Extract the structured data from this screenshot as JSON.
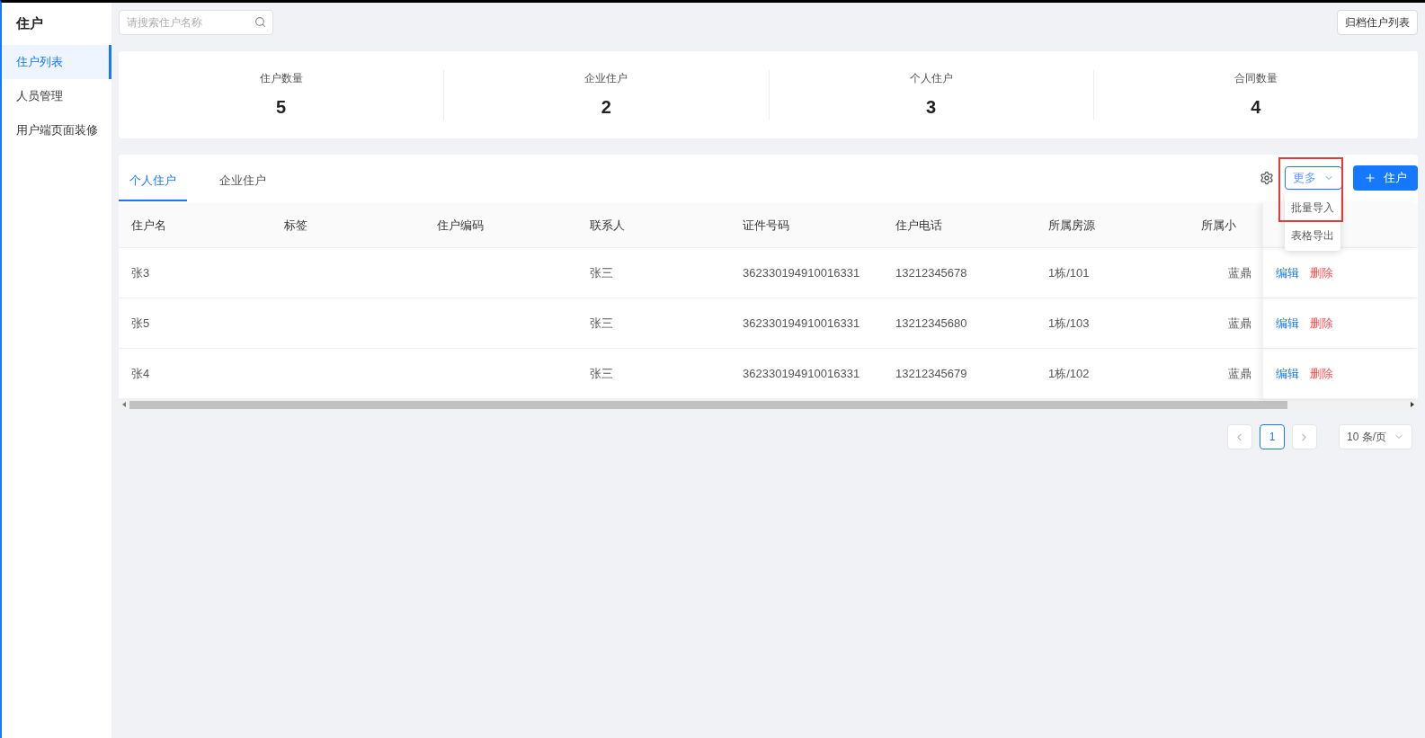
{
  "sidebar": {
    "title": "住户",
    "items": [
      {
        "label": "住户列表",
        "selected": true
      },
      {
        "label": "人员管理",
        "selected": false
      },
      {
        "label": "用户端页面装修",
        "selected": false
      }
    ]
  },
  "search": {
    "placeholder": "请搜索住户名称"
  },
  "archive_button": "归档住户列表",
  "stats": [
    {
      "label": "住户数量",
      "value": "5"
    },
    {
      "label": "企业住户",
      "value": "2"
    },
    {
      "label": "个人住户",
      "value": "3"
    },
    {
      "label": "合同数量",
      "value": "4"
    }
  ],
  "tabs": [
    {
      "label": "个人住户",
      "selected": true
    },
    {
      "label": "企业住户",
      "selected": false
    }
  ],
  "more_menu": {
    "label": "更多",
    "open": true,
    "highlighted": true,
    "items": [
      "批量导入",
      "表格导出"
    ]
  },
  "add_button": "住户",
  "table": {
    "columns": [
      "住户名",
      "标签",
      "住户编码",
      "联系人",
      "证件号码",
      "住户电话",
      "所属房源",
      "所属小"
    ],
    "rows": [
      {
        "name": "张3",
        "contact": "张三",
        "id_number": "362330194910016331",
        "phone": "13212345678",
        "unit": "1栋/101",
        "community": "蓝鼎",
        "actions": [
          "编辑",
          "删除"
        ]
      },
      {
        "name": "张5",
        "contact": "张三",
        "id_number": "362330194910016331",
        "phone": "13212345680",
        "unit": "1栋/103",
        "community": "蓝鼎",
        "actions": [
          "编辑",
          "删除"
        ]
      },
      {
        "name": "张4",
        "contact": "张三",
        "id_number": "362330194910016331",
        "phone": "13212345679",
        "unit": "1栋/102",
        "community": "蓝鼎",
        "actions": [
          "编辑",
          "删除"
        ]
      }
    ]
  },
  "pagination": {
    "pages": [
      {
        "label": "1",
        "selected": true
      }
    ],
    "page_size": "10 条/页"
  }
}
